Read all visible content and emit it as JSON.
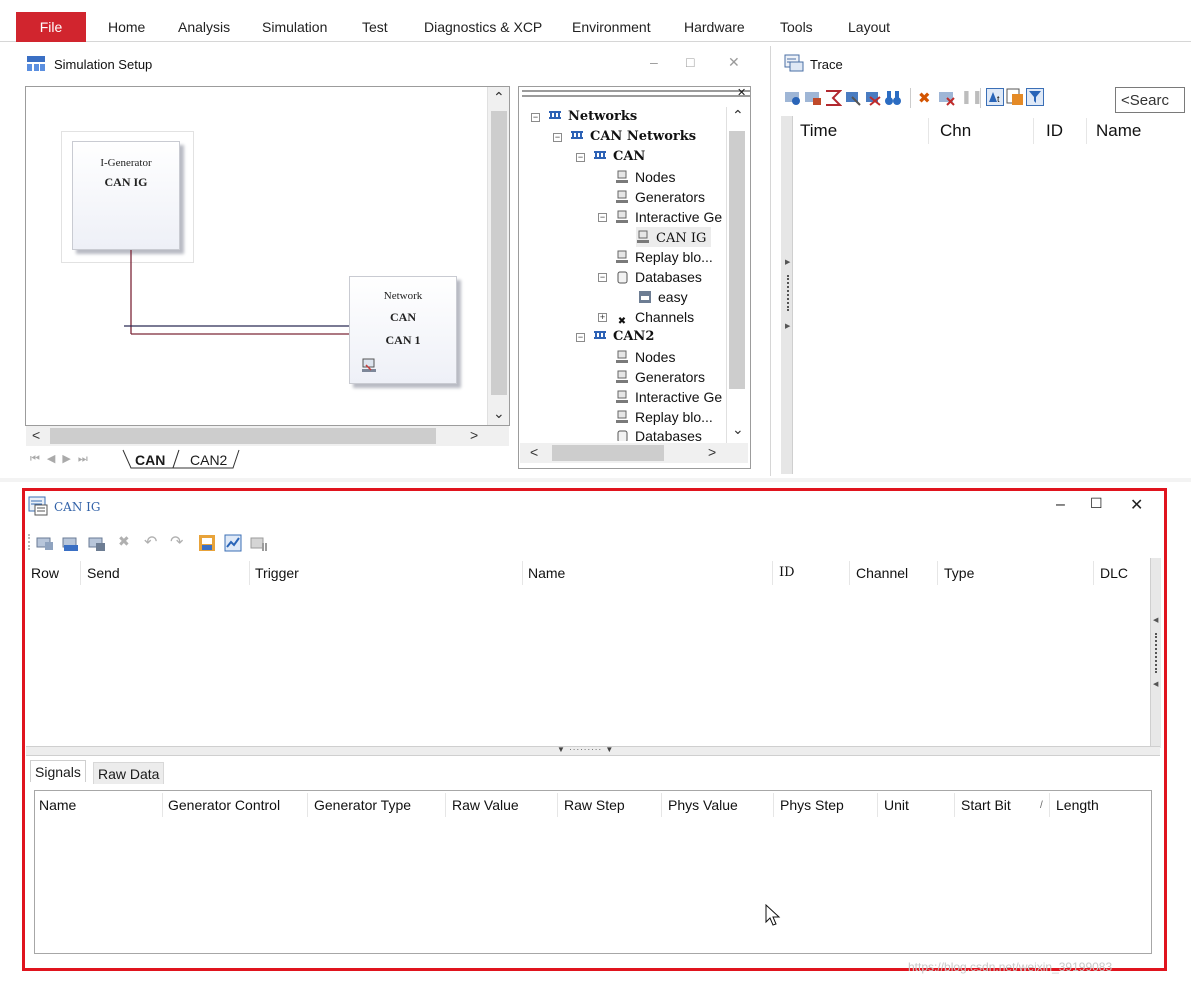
{
  "menu": {
    "file": "File",
    "items": [
      "Home",
      "Analysis",
      "Simulation",
      "Test",
      "Diagnostics & XCP",
      "Environment",
      "Hardware",
      "Tools",
      "Layout"
    ]
  },
  "sim_setup": {
    "title": "Simulation Setup",
    "ig_block": {
      "type": "I-Generator",
      "name": "CAN IG"
    },
    "network_block": {
      "type": "Network",
      "name": "CAN",
      "channel": "CAN 1"
    },
    "tabs": [
      "CAN",
      "CAN2"
    ]
  },
  "tree": {
    "rows": [
      "Networks",
      "CAN Networks",
      "CAN",
      "Nodes",
      "Generators",
      "Interactive Ge",
      "CAN IG",
      "Replay blo...",
      "Databases",
      "easy",
      "Channels",
      "CAN2",
      "Nodes",
      "Generators",
      "Interactive Ge",
      "Replay blo...",
      "Databases"
    ]
  },
  "trace": {
    "title": "Trace",
    "search_placeholder": "<Searc",
    "columns": [
      "Time",
      "Chn",
      "ID",
      "Name"
    ]
  },
  "canig": {
    "title": "CAN IG",
    "columns": [
      "Row",
      "Send",
      "Trigger",
      "Name",
      "ID",
      "Channel",
      "Type",
      "DLC"
    ],
    "tabs": [
      "Signals",
      "Raw Data"
    ],
    "signal_columns": [
      "Name",
      "Generator Control",
      "Generator Type",
      "Raw Value",
      "Raw Step",
      "Phys Value",
      "Phys Step",
      "Unit",
      "Start Bit",
      "Length"
    ]
  },
  "watermark": "https://blog.csdn.net/weixin_39199083",
  "colors": {
    "accent": "#d1252e",
    "highlight": "#e0141e"
  }
}
